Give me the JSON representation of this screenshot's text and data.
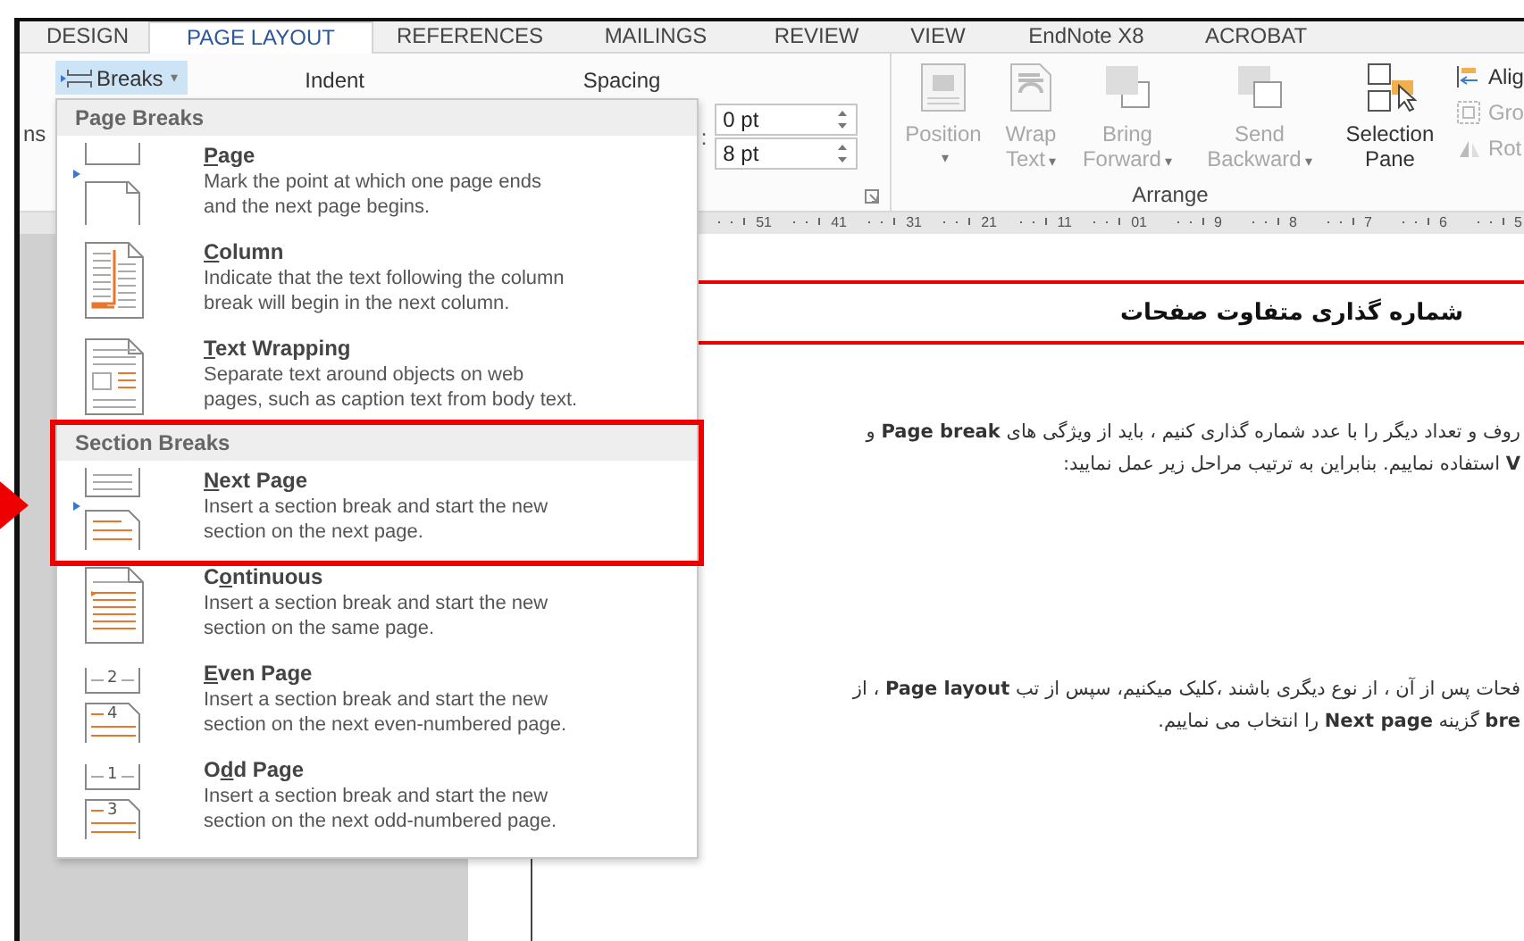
{
  "tabs": [
    {
      "label": "DESIGN",
      "selected": false
    },
    {
      "label": "PAGE LAYOUT",
      "selected": true
    },
    {
      "label": "REFERENCES",
      "selected": false
    },
    {
      "label": "MAILINGS",
      "selected": false
    },
    {
      "label": "REVIEW",
      "selected": false
    },
    {
      "label": "VIEW",
      "selected": false
    },
    {
      "label": "EndNote X8",
      "selected": false
    },
    {
      "label": "ACROBAT",
      "selected": false
    }
  ],
  "ribbon": {
    "cut_label": "ns",
    "breaks_button": "Breaks",
    "breaks_caret": "▾",
    "indent_label": "Indent",
    "spacing_label": "Spacing",
    "spacing_colon": ":",
    "spacing_fields": [
      {
        "value": "0 pt"
      },
      {
        "value": "8 pt"
      }
    ],
    "arrange_buttons": [
      {
        "kind": "position",
        "lines": [
          "Position"
        ],
        "caret": "▾",
        "disabled": true
      },
      {
        "kind": "wrap",
        "lines": [
          "Wrap",
          "Text"
        ],
        "caret": "▾",
        "disabled": true
      },
      {
        "kind": "bring",
        "lines": [
          "Bring",
          "Forward"
        ],
        "caret": "▾",
        "disabled": true
      },
      {
        "kind": "send",
        "lines": [
          "Send",
          "Backward"
        ],
        "caret": "▾",
        "disabled": true
      },
      {
        "kind": "selection",
        "lines": [
          "Selection",
          "Pane"
        ],
        "disabled": false
      }
    ],
    "small_buttons": [
      {
        "kind": "align",
        "label": "Alig",
        "disabled": false
      },
      {
        "kind": "group",
        "label": "Gro",
        "disabled": true
      },
      {
        "kind": "rotate",
        "label": "Rot",
        "disabled": true
      }
    ],
    "arrange_label": "Arrange"
  },
  "ruler": [
    "51",
    "41",
    "31",
    "21",
    "11",
    "01",
    "9",
    "8",
    "7",
    "6",
    "5"
  ],
  "document": {
    "heading": "شماره گذاری متفاوت صفحات",
    "paragraphs": [
      [
        "روف و تعداد دیگر را با عدد شماره گذاری کنیم ، باید از ویژگی های **Page break** و",
        "**V** استفاده نماییم. بنابراین به ترتیب مراحل زیر عمل نمایید:"
      ],
      [
        "فحات پس از آن ، از نوع دیگری باشند ،کلیک میکنیم، سپس از تب **Page layout** ، از",
        "**bre** گزینه **Next page** را انتخاب می نماییم."
      ]
    ]
  },
  "menu": {
    "sections": [
      {
        "header": "Page Breaks",
        "items": [
          {
            "kind": "page",
            "key": "P",
            "after": "age",
            "description": [
              "Mark the point at which one page ends",
              "and the next page begins."
            ],
            "highlighted": false
          },
          {
            "kind": "column",
            "key": "C",
            "after": "olumn",
            "description": [
              "Indicate that the text following the column",
              "break will begin in the next column."
            ],
            "highlighted": false
          },
          {
            "kind": "wrapping",
            "key": "T",
            "after": "ext Wrapping",
            "description": [
              "Separate text around objects on web",
              "pages, such as caption text from body text."
            ],
            "highlighted": false
          }
        ]
      },
      {
        "header": "Section Breaks",
        "items": [
          {
            "kind": "next",
            "key": "N",
            "after": "ext Page",
            "description": [
              "Insert a section break and start the new",
              "section on the next page."
            ],
            "highlighted": true
          },
          {
            "kind": "continuous",
            "before": "C",
            "key": "o",
            "after": "ntinuous",
            "description": [
              "Insert a section break and start the new",
              "section on the same page."
            ],
            "highlighted": false
          },
          {
            "kind": "even",
            "key": "E",
            "after": "ven Page",
            "numbers": [
              "2",
              "4"
            ],
            "description": [
              "Insert a section break and start the new",
              "section on the next even-numbered page."
            ],
            "highlighted": false
          },
          {
            "kind": "odd",
            "before": "O",
            "key": "d",
            "after": "d Page",
            "numbers": [
              "1",
              "3"
            ],
            "description": [
              "Insert a section break and start the new",
              "section on the next odd-numbered page."
            ],
            "highlighted": false
          }
        ]
      }
    ]
  }
}
